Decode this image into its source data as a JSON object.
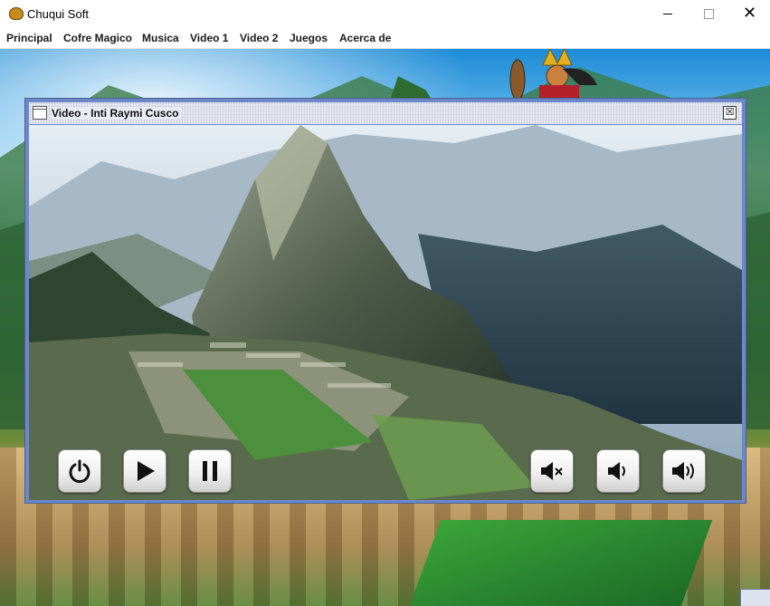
{
  "window": {
    "title": "Chuqui Soft",
    "icon": "app-logo-icon",
    "controls": [
      "minimize-icon",
      "maximize-icon",
      "close-icon"
    ],
    "close_glyph": "✕"
  },
  "menu": {
    "items": [
      "Principal",
      "Cofre Magico",
      "Musica",
      "Video 1",
      "Video 2",
      "Juegos",
      "Acerca de"
    ]
  },
  "video_window": {
    "title": "Video - Inti Raymi Cusco",
    "close_glyph": "☒",
    "frame_color": "#6d88c8",
    "controls_left": [
      {
        "name": "power-button",
        "icon": "power-icon"
      },
      {
        "name": "play-button",
        "icon": "play-icon"
      },
      {
        "name": "pause-button",
        "icon": "pause-icon"
      }
    ],
    "controls_right": [
      {
        "name": "mute-button",
        "icon": "volume-mute-icon"
      },
      {
        "name": "volume-down-button",
        "icon": "volume-low-icon"
      },
      {
        "name": "volume-up-button",
        "icon": "volume-high-icon"
      }
    ]
  }
}
